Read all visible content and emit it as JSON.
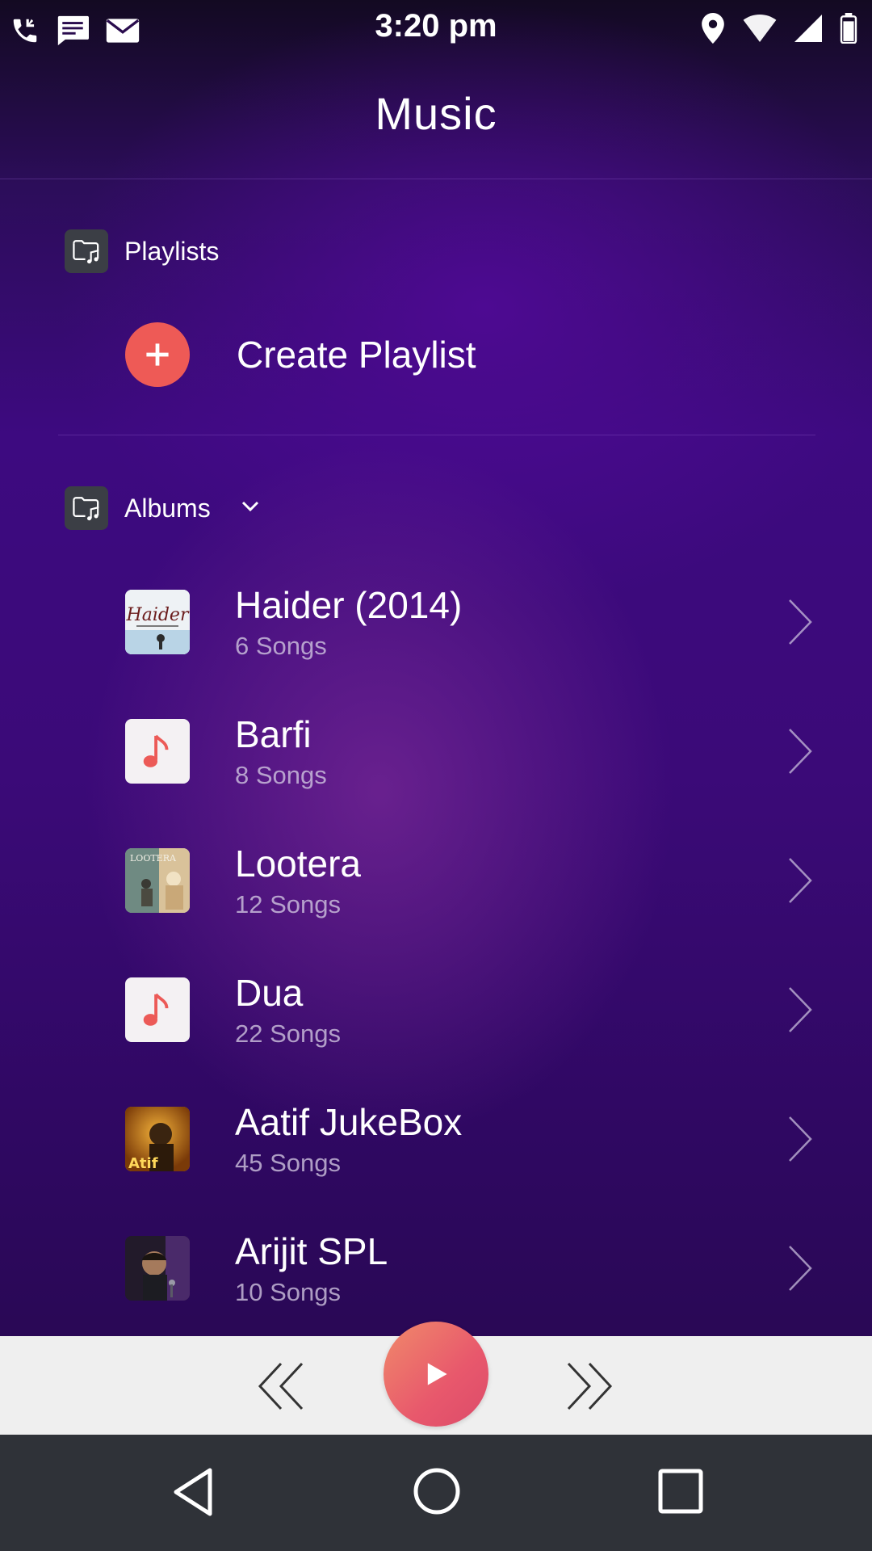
{
  "status_bar": {
    "time": "3:20 pm",
    "left_icons": [
      "phone-call-icon",
      "message-icon",
      "mail-icon"
    ],
    "right_icons": [
      "location-icon",
      "wifi-icon",
      "signal-icon",
      "battery-icon"
    ]
  },
  "header": {
    "title": "Music"
  },
  "playlists": {
    "label": "Playlists",
    "create_label": "Create Playlist"
  },
  "albums": {
    "label": "Albums",
    "items": [
      {
        "name": "Haider (2014)",
        "count": "6 Songs",
        "art": "album-art-haider"
      },
      {
        "name": "Barfi",
        "count": "8 Songs",
        "art": "music-note-placeholder"
      },
      {
        "name": "Lootera",
        "count": "12 Songs",
        "art": "album-art-lootera"
      },
      {
        "name": "Dua",
        "count": "22 Songs",
        "art": "music-note-placeholder"
      },
      {
        "name": "Aatif JukeBox",
        "count": "45 Songs",
        "art": "album-art-aatif"
      },
      {
        "name": "Arijit SPL",
        "count": "10 Songs",
        "art": "album-art-arijit"
      }
    ]
  },
  "colors": {
    "accent": "#ee5a56",
    "background": "#3b0a78",
    "player_bar": "#efefef",
    "nav_bar": "#2f3238"
  }
}
